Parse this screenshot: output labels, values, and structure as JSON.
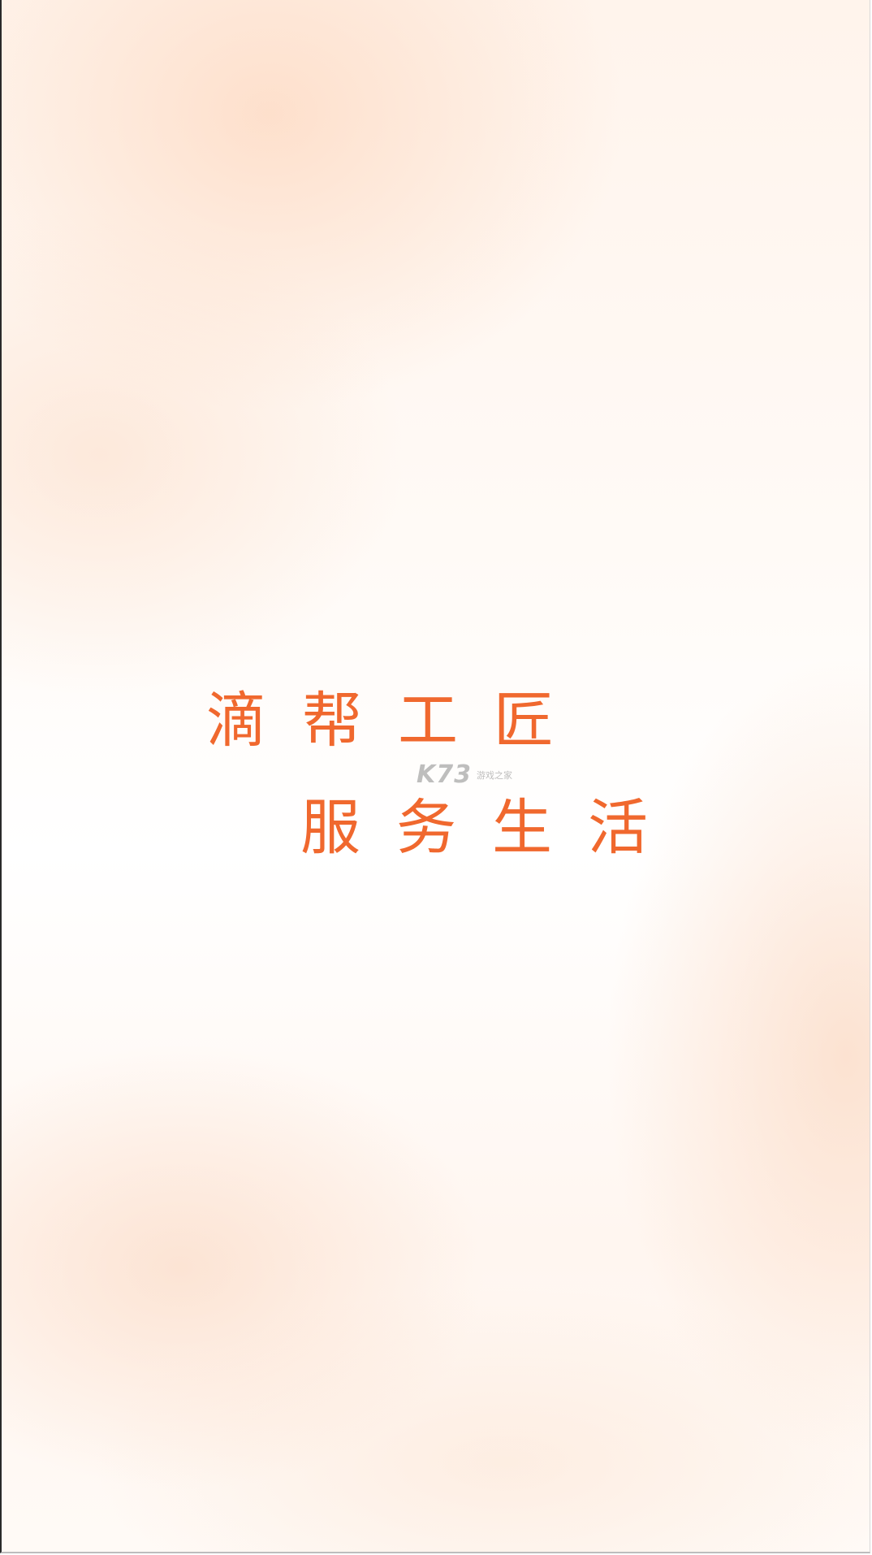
{
  "splash": {
    "slogan_line_1": "滴帮工匠",
    "slogan_line_2": "服务生活",
    "accent_color": "#f0682e"
  },
  "watermark": {
    "logo_text": "K73",
    "site_text": "游戏之家"
  }
}
